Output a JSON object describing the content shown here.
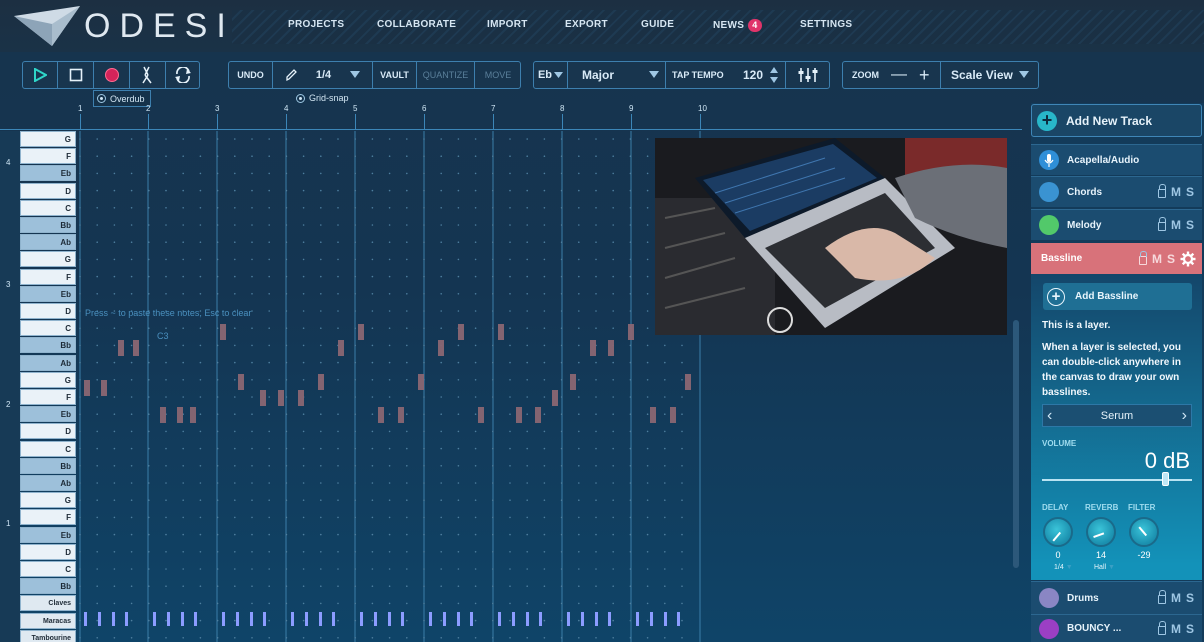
{
  "app": {
    "logo_text": "ODESI"
  },
  "nav": [
    {
      "label": "PROJECTS"
    },
    {
      "label": "COLLABORATE"
    },
    {
      "label": "IMPORT"
    },
    {
      "label": "EXPORT"
    },
    {
      "label": "GUIDE"
    },
    {
      "label": "NEWS",
      "badge": "4"
    },
    {
      "label": "SETTINGS"
    }
  ],
  "toolbar": {
    "undo": "UNDO",
    "grid_value": "1/4",
    "vault": "VAULT",
    "quantize": "QUANTIZE",
    "move": "MOVE",
    "key": "Eb",
    "scale": "Major",
    "tap_tempo": "TAP TEMPO",
    "tempo": "120",
    "zoom": "ZOOM",
    "view": "Scale View",
    "overdub": "Overdub",
    "grid_snap": "Grid-snap"
  },
  "ruler": [
    "1",
    "2",
    "3",
    "4",
    "5",
    "6",
    "7",
    "8",
    "9",
    "10"
  ],
  "piano": {
    "keys": [
      "G",
      "F",
      "Eb",
      "D",
      "C",
      "Bb",
      "Ab",
      "G",
      "F",
      "Eb",
      "D",
      "C",
      "Bb",
      "Ab",
      "G",
      "F",
      "Eb",
      "D",
      "C",
      "Bb",
      "Ab",
      "G",
      "F",
      "Eb",
      "D",
      "C",
      "Bb",
      "Claves",
      "Maracas",
      "Tambourine"
    ],
    "octaves": [
      "4",
      "3",
      "2",
      "1"
    ]
  },
  "canvas": {
    "hint": "Press ~ to paste these notes, Esc to clear",
    "note_label": "C3"
  },
  "sidebar": {
    "add_track": "Add New Track",
    "tracks": [
      {
        "name": "Acapella/Audio",
        "color": "#2f8fd8"
      },
      {
        "name": "Chords",
        "color": "#3a93d2",
        "lock": "",
        "m": "M",
        "s": "S"
      },
      {
        "name": "Melody",
        "color": "#52c96a",
        "lock": "",
        "m": "M",
        "s": "S"
      }
    ],
    "bassline": {
      "name": "Bassline",
      "m": "M",
      "s": "S",
      "color": "#d8727a"
    },
    "add_bassline": "Add Bassline",
    "layer_title": "This is a layer.",
    "layer_desc": "When a layer is selected, you can double-click anywhere in the canvas to draw your own basslines.",
    "instrument": "Serum",
    "volume_label": "VOLUME",
    "volume_value": "0 dB",
    "volume_level": 0.82,
    "effects": [
      {
        "label": "DELAY",
        "value": "0",
        "sub": "1/4"
      },
      {
        "label": "REVERB",
        "value": "14",
        "sub": "Hall"
      },
      {
        "label": "FILTER",
        "value": "-29",
        "sub": ""
      }
    ],
    "bottom_tracks": [
      {
        "name": "Drums",
        "color": "#8a86c4",
        "m": "M",
        "s": "S"
      },
      {
        "name": "BOUNCY ...",
        "color": "#9b3fc4",
        "m": "M",
        "s": "S"
      }
    ]
  }
}
